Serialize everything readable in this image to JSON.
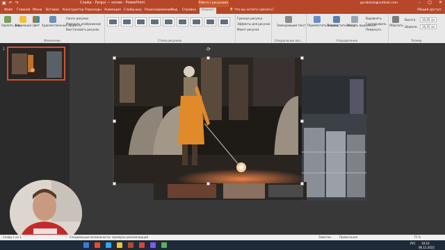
{
  "title_bar": {
    "document_title": "Слайд - Pyrgui — нолик  ·  PowerPoint",
    "context_tab": "Работа с рисунками",
    "account": "gsrabotat@outlook.com"
  },
  "tabs": [
    "Файл",
    "Главная",
    "Меню",
    "Вставка",
    "Конструктор",
    "Переходы",
    "Анимация",
    "Слайд-шоу",
    "Рецензирование",
    "Вид",
    "Справка",
    "Формат"
  ],
  "active_tab": "Формат",
  "tell_me": "Что вы хотите сделать?",
  "share": "Общий доступ",
  "ribbon": {
    "remove_bg": "Удалить фон",
    "corrections": "Коррекция",
    "color": "Цвет",
    "artistic": "Художественные эффекты",
    "compress": "Сжать рисунки",
    "change_picture": "Изменить изображение",
    "reset_picture": "Восстановить рисунок",
    "group_adjust": "Изменение",
    "group_styles": "Стили рисунков",
    "border": "Граница рисунка",
    "effects": "Эффекты для рисунка",
    "layout": "Макет рисунка",
    "alt_text": "Замещающий текст",
    "group_accessibility": "Специальные воз...",
    "bring_forward": "Переместить вперед",
    "send_backward": "Переместить назад",
    "selection_pane": "Область выделения",
    "align": "Выровнять",
    "group": "Группировать",
    "rotate": "Повернуть",
    "group_arrange": "Упорядочение",
    "crop": "Обрезать",
    "height_label": "Высота:",
    "height_value": "10,05 см",
    "width_label": "Ширина:",
    "width_value": "16,35 см",
    "group_size": "Размер"
  },
  "slide_panel": {
    "slide_number": "1"
  },
  "status_bar": {
    "slide_info": "Слайд 1 из 1",
    "accessibility": "Специальные возможности: проверка рекомендаций",
    "notes": "Заметки",
    "comments": "Примечания",
    "zoom": "75 %"
  },
  "taskbar": {
    "time": "19:10",
    "date": "06.12.2022",
    "lang": "РУС"
  },
  "colors": {
    "accent": "#b7472a",
    "ribbon_bg": "#e8e8e8",
    "canvas_bg": "#383838",
    "taskbar_bg": "#1f2a38"
  }
}
